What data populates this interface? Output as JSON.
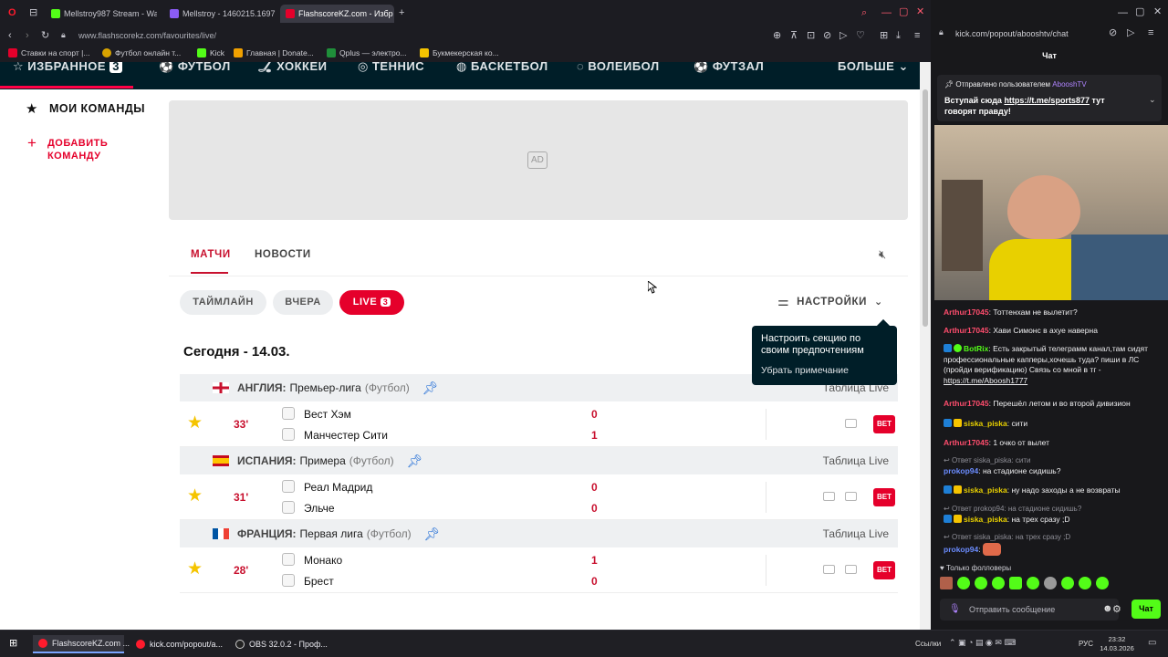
{
  "browser": {
    "tabs": [
      {
        "label": "Mellstroy987 Stream - Wa",
        "color": "#53fc18"
      },
      {
        "label": "Mellstroy - 1460215.1697",
        "color": "#8b5cf6"
      },
      {
        "label": "FlashscoreKZ.com - Избр",
        "color": "#e5002b"
      }
    ],
    "url_domain": "www.flashscorekz.com",
    "url_path": "/favourites/live/",
    "bookmarks": [
      "Ставки на спорт |...",
      "Футбол онлайн т...",
      "Kick",
      "Главная | Donate...",
      "Qplus — электро...",
      "Букмекерская ко..."
    ]
  },
  "sport_nav": {
    "items": [
      "ИЗБРАННОЕ",
      "ФУТБОЛ",
      "ХОККЕЙ",
      "ТЕННИС",
      "БАСКЕТБОЛ",
      "ВОЛЕЙБОЛ",
      "ФУТЗАЛ",
      "БОЛЬШЕ"
    ],
    "favourites_count": "3"
  },
  "sidebar": {
    "my_teams": "МОИ КОМАНДЫ",
    "add_team_1": "ДОБАВИТЬ",
    "add_team_2": "КОМАНДУ"
  },
  "ad": {
    "label": "AD"
  },
  "tabs": {
    "matches": "МАТЧИ",
    "news": "НОВОСТИ"
  },
  "filters": {
    "timeline": "ТАЙМЛАЙН",
    "yesterday": "ВЧЕРА",
    "live": "LIVE",
    "live_count": "3"
  },
  "settings": {
    "label": "НАСТРОЙКИ"
  },
  "tooltip": {
    "line1": "Настроить секцию по",
    "line2": "своим предпочтениям",
    "dismiss": "Убрать примечание"
  },
  "date_heading": "Сегодня - 14.03.",
  "leagues": [
    {
      "country": "АНГЛИЯ:",
      "name": "Премьер-лига",
      "sport": "(Футбол)",
      "table_link": "Таблица Live",
      "match": {
        "minute": "33'",
        "home": "Вест Хэм",
        "away": "Манчестер Сити",
        "home_score": "0",
        "away_score": "1",
        "bet": "BET"
      }
    },
    {
      "country": "ИСПАНИЯ:",
      "name": "Примера",
      "sport": "(Футбол)",
      "table_link": "Таблица Live",
      "match": {
        "minute": "31'",
        "home": "Реал Мадрид",
        "away": "Эльче",
        "home_score": "0",
        "away_score": "0",
        "bet": "BET"
      }
    },
    {
      "country": "ФРАНЦИЯ:",
      "name": "Первая лига",
      "sport": "(Футбол)",
      "table_link": "Таблица Live",
      "match": {
        "minute": "28'",
        "home": "Монако",
        "away": "Брест",
        "home_score": "1",
        "away_score": "0",
        "bet": "BET"
      }
    }
  ],
  "chat": {
    "url": "kick.com/popout/abooshtv/chat",
    "title": "Чат",
    "pinned_by": "Отправлено пользователем",
    "pinned_user": "AbooshTV",
    "pinned_text": "Вступай сюда",
    "pinned_link": "https://t.me/sports877",
    "pinned_tail": "тут говорят правду!",
    "messages": [
      {
        "user": "Arthur17045",
        "text": ": Тоттенхам не вылетит?",
        "color": "#ff4d6d"
      },
      {
        "user": "Arthur17045",
        "text": ": Хави Симонс в ахуе наверна",
        "color": "#ff4d6d"
      },
      {
        "user": "BotRix",
        "text": ": Есть закрытый телеграмм канал,там сидят профессиональные капперы,хочешь туда? пиши в ЛС (пройди верификацию) Связь со мной в тг -",
        "link": "https://t.me/Aboosh1777",
        "color": "#53fc18"
      },
      {
        "user": "Arthur17045",
        "text": ": Перешёл летом и во второй дивизион",
        "color": "#ff4d6d"
      },
      {
        "user": "siska_piska",
        "text": ": сити",
        "color": "#e8d000"
      },
      {
        "user": "Arthur17045",
        "text": ": 1 очко от вылет",
        "color": "#ff4d6d"
      },
      {
        "reply": "Ответ siska_piska: сити",
        "user": "prokop94",
        "text": ": на стадионе сидишь?",
        "color": "#6b8cff"
      },
      {
        "user": "siska_piska",
        "text": ": ну надо заходы а не возвраты",
        "color": "#e8d000"
      },
      {
        "reply": "Ответ prokop94: на стадионе сидишь?",
        "user": "siska_piska",
        "text": ": на трех сразу ;D",
        "color": "#e8d000"
      },
      {
        "reply": "Ответ siska_piska: на трех сразу ;D",
        "user": "prokop94",
        "text": ":",
        "color": "#6b8cff"
      }
    ],
    "followers_only": "Только фолловеры",
    "input_placeholder": "Отправить сообщение",
    "send": "Чат"
  },
  "taskbar": {
    "tasks": [
      "FlashscoreKZ.com ...",
      "kick.com/popout/a...",
      "OBS 32.0.2 - Проф..."
    ],
    "links": "Ссылки",
    "lang": "РУС",
    "time": "23:32",
    "date": "14.03.2026"
  }
}
